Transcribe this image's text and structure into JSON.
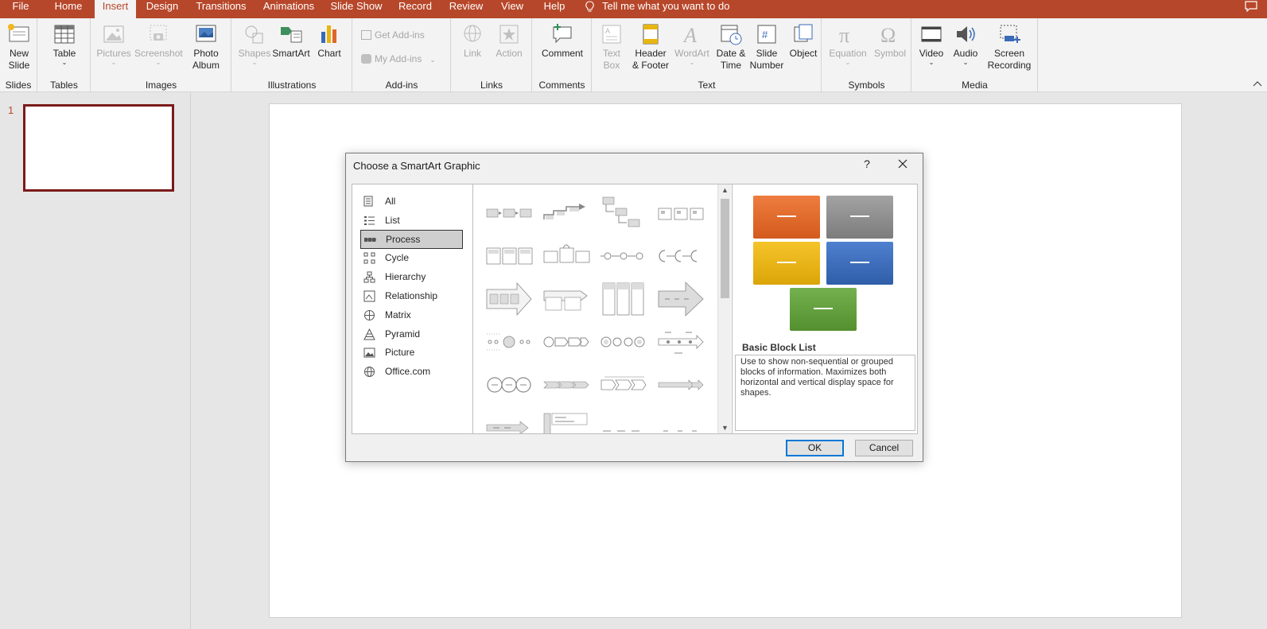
{
  "tabs": [
    "File",
    "Home",
    "Insert",
    "Design",
    "Transitions",
    "Animations",
    "Slide Show",
    "Record",
    "Review",
    "View",
    "Help"
  ],
  "active_tab": "Insert",
  "tell_me": "Tell me what you want to do",
  "ribbon": {
    "slides": {
      "label": "Slides",
      "new_slide": "New\nSlide"
    },
    "tables": {
      "label": "Tables",
      "table": "Table"
    },
    "images": {
      "label": "Images",
      "pictures": "Pictures",
      "screenshot": "Screenshot",
      "photo_album": "Photo\nAlbum"
    },
    "illustrations": {
      "label": "Illustrations",
      "shapes": "Shapes",
      "smartart": "SmartArt",
      "chart": "Chart"
    },
    "addins": {
      "label": "Add-ins",
      "get_addins": "Get Add-ins",
      "my_addins": "My Add-ins"
    },
    "links": {
      "label": "Links",
      "link": "Link",
      "action": "Action"
    },
    "comments": {
      "label": "Comments",
      "comment": "Comment"
    },
    "text": {
      "label": "Text",
      "text_box": "Text\nBox",
      "header_footer": "Header\n& Footer",
      "wordart": "WordArt",
      "date_time": "Date &\nTime",
      "slide_number": "Slide\nNumber",
      "object": "Object"
    },
    "symbols": {
      "label": "Symbols",
      "equation": "Equation",
      "symbol": "Symbol"
    },
    "media": {
      "label": "Media",
      "video": "Video",
      "audio": "Audio",
      "screen_recording": "Screen\nRecording"
    }
  },
  "slide_pane": {
    "slide_number": "1"
  },
  "dialog": {
    "title": "Choose a SmartArt Graphic",
    "help": "?",
    "categories": [
      "All",
      "List",
      "Process",
      "Cycle",
      "Hierarchy",
      "Relationship",
      "Matrix",
      "Pyramid",
      "Picture",
      "Office.com"
    ],
    "selected_category": "Process",
    "preview": {
      "name": "Basic Block List",
      "description": "Use to show non-sequential or grouped blocks of information. Maximizes both horizontal and vertical display space for shapes.",
      "colors": [
        "#e0672a",
        "#8c8c8c",
        "#e8b40f",
        "#3a6ab8",
        "#5f9c3e"
      ]
    },
    "ok": "OK",
    "cancel": "Cancel"
  }
}
